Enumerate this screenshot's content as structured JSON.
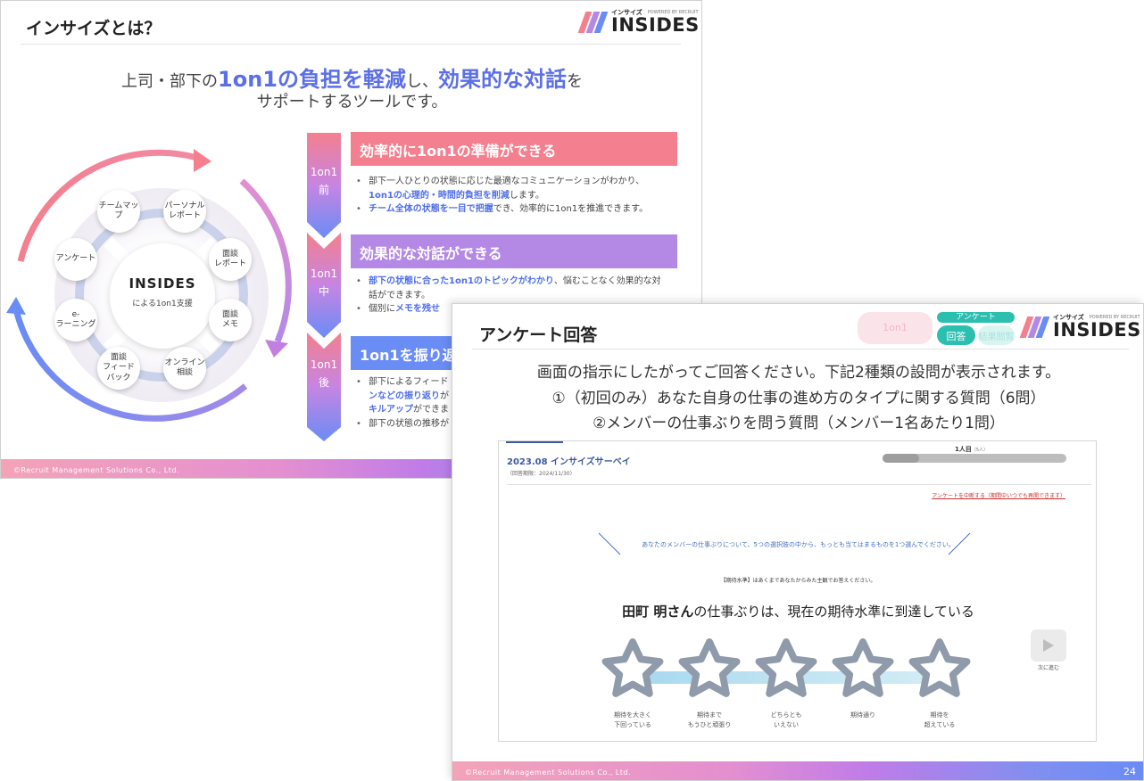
{
  "slide1": {
    "title": "インサイズとは？",
    "logo_small": "インサイズ",
    "logo_powered": "POWERED BY RECRUIT",
    "logo_big": "INSIDES",
    "tagline": {
      "l1_a": "上司・部下の",
      "l1_b": "1on1の負担を軽減",
      "l1_c": "し、",
      "l1_d": "効果的な対話",
      "l1_e": "を",
      "l2": "サポートするツールです。"
    },
    "center_logo": "INSIDES",
    "center_sub": "による1on1支援",
    "nodes": [
      "チームマップ",
      "パーソナル\nレポート",
      "面談\nレポート",
      "面談\nメモ",
      "オンライン\n相談",
      "面談\nフィード\nバック",
      "e-\nラーニング",
      "アンケート"
    ],
    "phases": [
      {
        "l1": "1on1",
        "l2": "前"
      },
      {
        "l1": "1on1",
        "l2": "中"
      },
      {
        "l1": "1on1",
        "l2": "後"
      }
    ],
    "features": [
      {
        "heading": "効率的に1on1の準備ができる",
        "b1_a": "部下一人ひとりの状態に応じた最適なコミュニケーションがわかり、",
        "b1_b": "1on1の心理的・時間的負担を削減",
        "b1_c": "します。",
        "b2_a": "チーム全体の状態を一目で把握",
        "b2_b": "でき、効率的に1on1を推進できます。"
      },
      {
        "heading": "効果的な対話ができる",
        "b1_a": "部下の状態に合った1on1のトピックがわかり",
        "b1_b": "、悩むことなく効果的な対話ができます。",
        "b2_a": "個別に",
        "b2_b": "メモを残せ"
      },
      {
        "heading": "1on1を振り返",
        "b1_a": "部下によるフィード",
        "b1_b": "ンなどの振り返り",
        "b1_c": "が",
        "b1_d": "キルアップ",
        "b1_e": "ができま",
        "b2_a": "部下の状態の推移が"
      }
    ],
    "footer": "©Recruit Management Solutions Co., Ltd."
  },
  "slide2": {
    "title": "アンケート回答",
    "tab_1on1": "1on1",
    "tab_survey": "アンケート",
    "tab_answer": "回答",
    "tab_result": "結果閲覧",
    "logo_small": "インサイズ",
    "logo_powered": "POWERED BY RECRUIT",
    "logo_big": "INSIDES",
    "instructions": [
      "画面の指示にしたがってご回答ください。下記2種類の設問が表示されます。",
      "①（初回のみ）あなた自身の仕事の進め方のタイプに関する質問（6問）",
      "②メンバーの仕事ぶりを問う質問（メンバー1名あたり1問）"
    ],
    "survey": {
      "title": "2023.08 インサイズサーベイ",
      "period": "（回答期限：2024/11/30）",
      "count": "1人目",
      "count_total": "（5人）",
      "progress": 0.2,
      "suspend": "アンケートを中断する（期間中いつでも再開できます）",
      "instruction": "あなたのメンバーの仕事ぶりについて、5つの選択肢の中から、もっとも当てはまるものを1つ選んでください。",
      "note": "【期待水準】はあくまであなたからみた主観でお答えください。",
      "question_name": "田町 明さん",
      "question_rest": "の仕事ぶりは、現在の期待水準に到達している",
      "options": [
        "期待を大きく\n下回っている",
        "期待まで\nもうひと頑張り",
        "どちらとも\nいえない",
        "期待通り",
        "期待を\n超えている"
      ],
      "next": "次に進む"
    },
    "footer": "©Recruit Management Solutions Co., Ltd.",
    "page": "24"
  },
  "colors": {
    "pink": "#f47f8e",
    "purple": "#b489e6",
    "blue": "#6a8cf5",
    "accent_text": "#5b6fe6",
    "teal": "#2bbfb0"
  }
}
